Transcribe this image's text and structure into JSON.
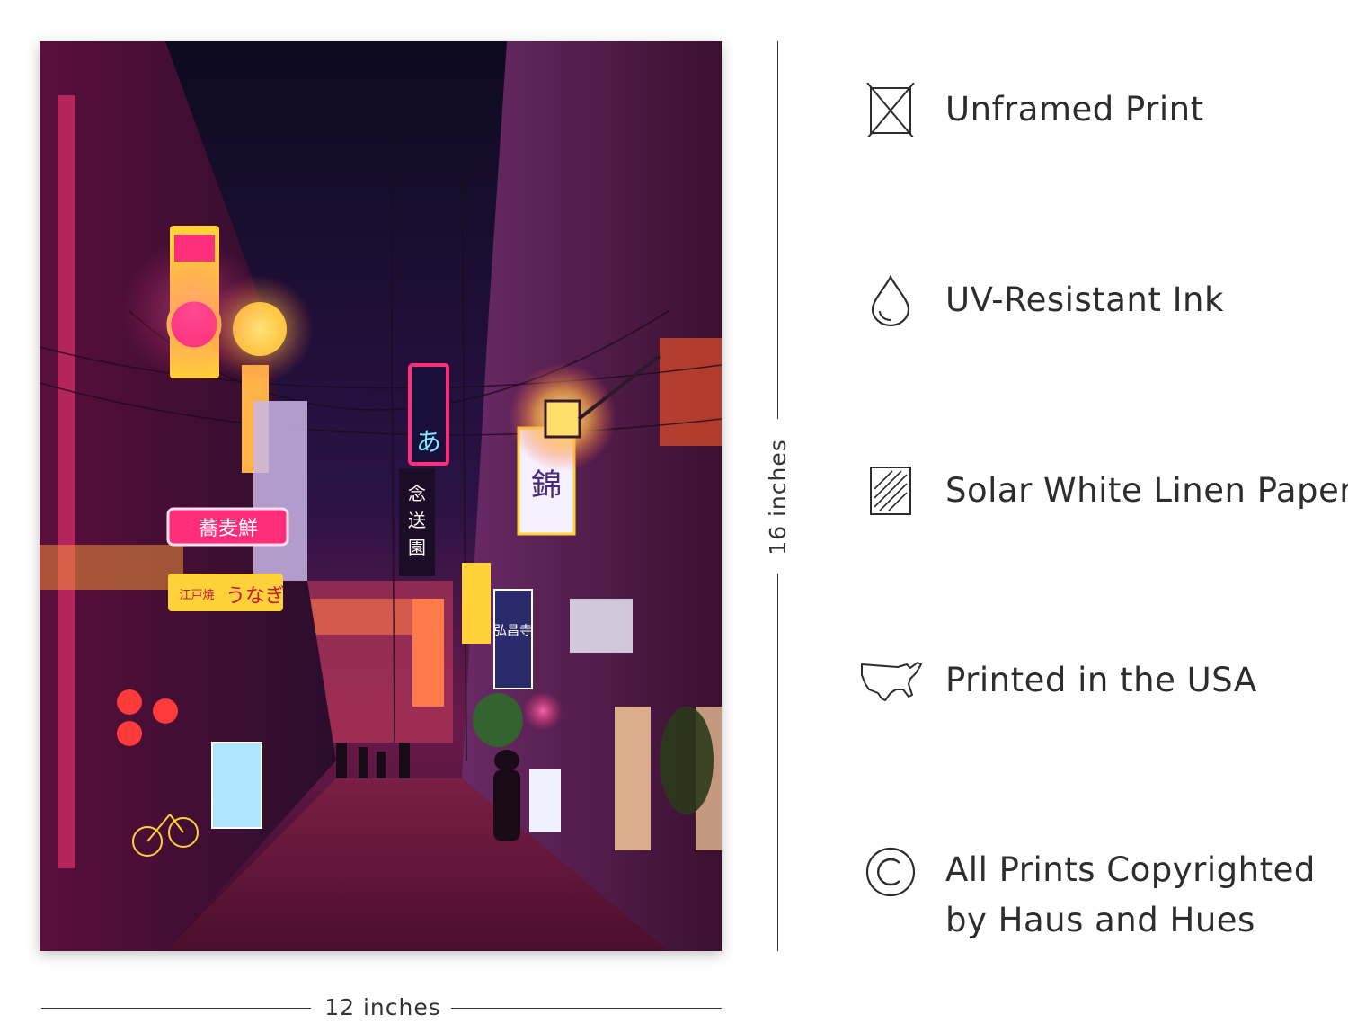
{
  "poster": {
    "signs": [
      "あ",
      "錦",
      "弘昌寺",
      "蕎麦鮮",
      "江戸焼",
      "うなぎ",
      "念",
      "送",
      "園"
    ]
  },
  "dimensions": {
    "height_label": "16 inches",
    "width_label": "12 inches"
  },
  "features": [
    {
      "icon": "unframed-box-icon",
      "label": "Unframed Print"
    },
    {
      "icon": "ink-drop-icon",
      "label": "UV-Resistant Ink"
    },
    {
      "icon": "linen-paper-icon",
      "label": "Solar White Linen Paper"
    },
    {
      "icon": "usa-map-icon",
      "label": "Printed in the USA"
    },
    {
      "icon": "copyright-icon",
      "label_line1": "All Prints Copyrighted",
      "label_line2": "by Haus and Hues"
    }
  ],
  "colors": {
    "text": "#2d2d2d",
    "neon_pink": "#ff2d7a",
    "neon_yellow": "#ffd23a",
    "night_sky": "#150a26"
  }
}
